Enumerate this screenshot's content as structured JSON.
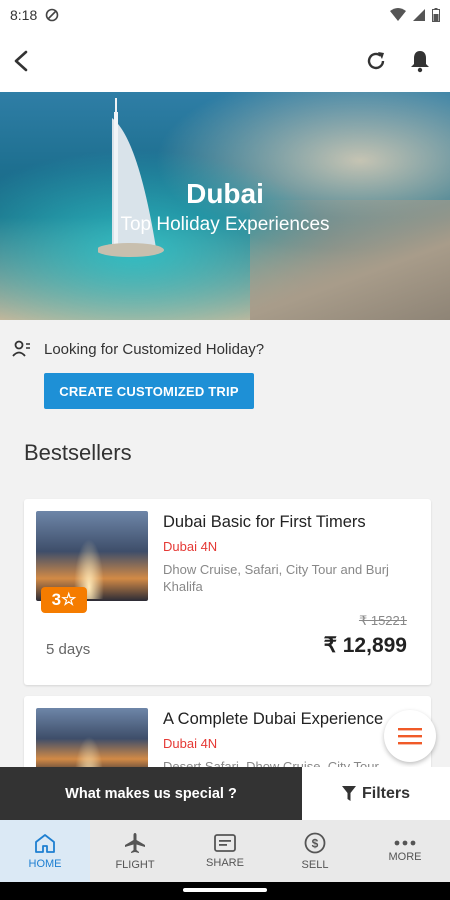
{
  "status": {
    "time": "8:18"
  },
  "hero": {
    "title": "Dubai",
    "subtitle": "Top Holiday Experiences"
  },
  "custom": {
    "prompt": "Looking for Customized Holiday?",
    "button": "CREATE CUSTOMIZED TRIP"
  },
  "bestsellers": {
    "title": "Bestsellers",
    "cards": [
      {
        "name": "Dubai Basic for First Timers",
        "location": "Dubai 4N",
        "description": "Dhow Cruise, Safari, City Tour and Burj Khalifa",
        "rating_badge": "3☆",
        "old_price": "₹ 15221",
        "price": "₹ 12,899",
        "duration": "5 days"
      },
      {
        "name": "A Complete Dubai Experience",
        "location": "Dubai 4N",
        "description": "Desert Safari, Dhow Cruise, City Tour"
      }
    ]
  },
  "actions": {
    "special": "What makes us special ?",
    "filters": "Filters"
  },
  "nav": {
    "home": "HOME",
    "flight": "FLIGHT",
    "share": "SHARE",
    "sell": "SELL",
    "more": "MORE"
  },
  "colors": {
    "accent": "#1e90d6",
    "location": "#e53935",
    "badge": "#f57c00",
    "nav_active": "#1e7fd1"
  }
}
